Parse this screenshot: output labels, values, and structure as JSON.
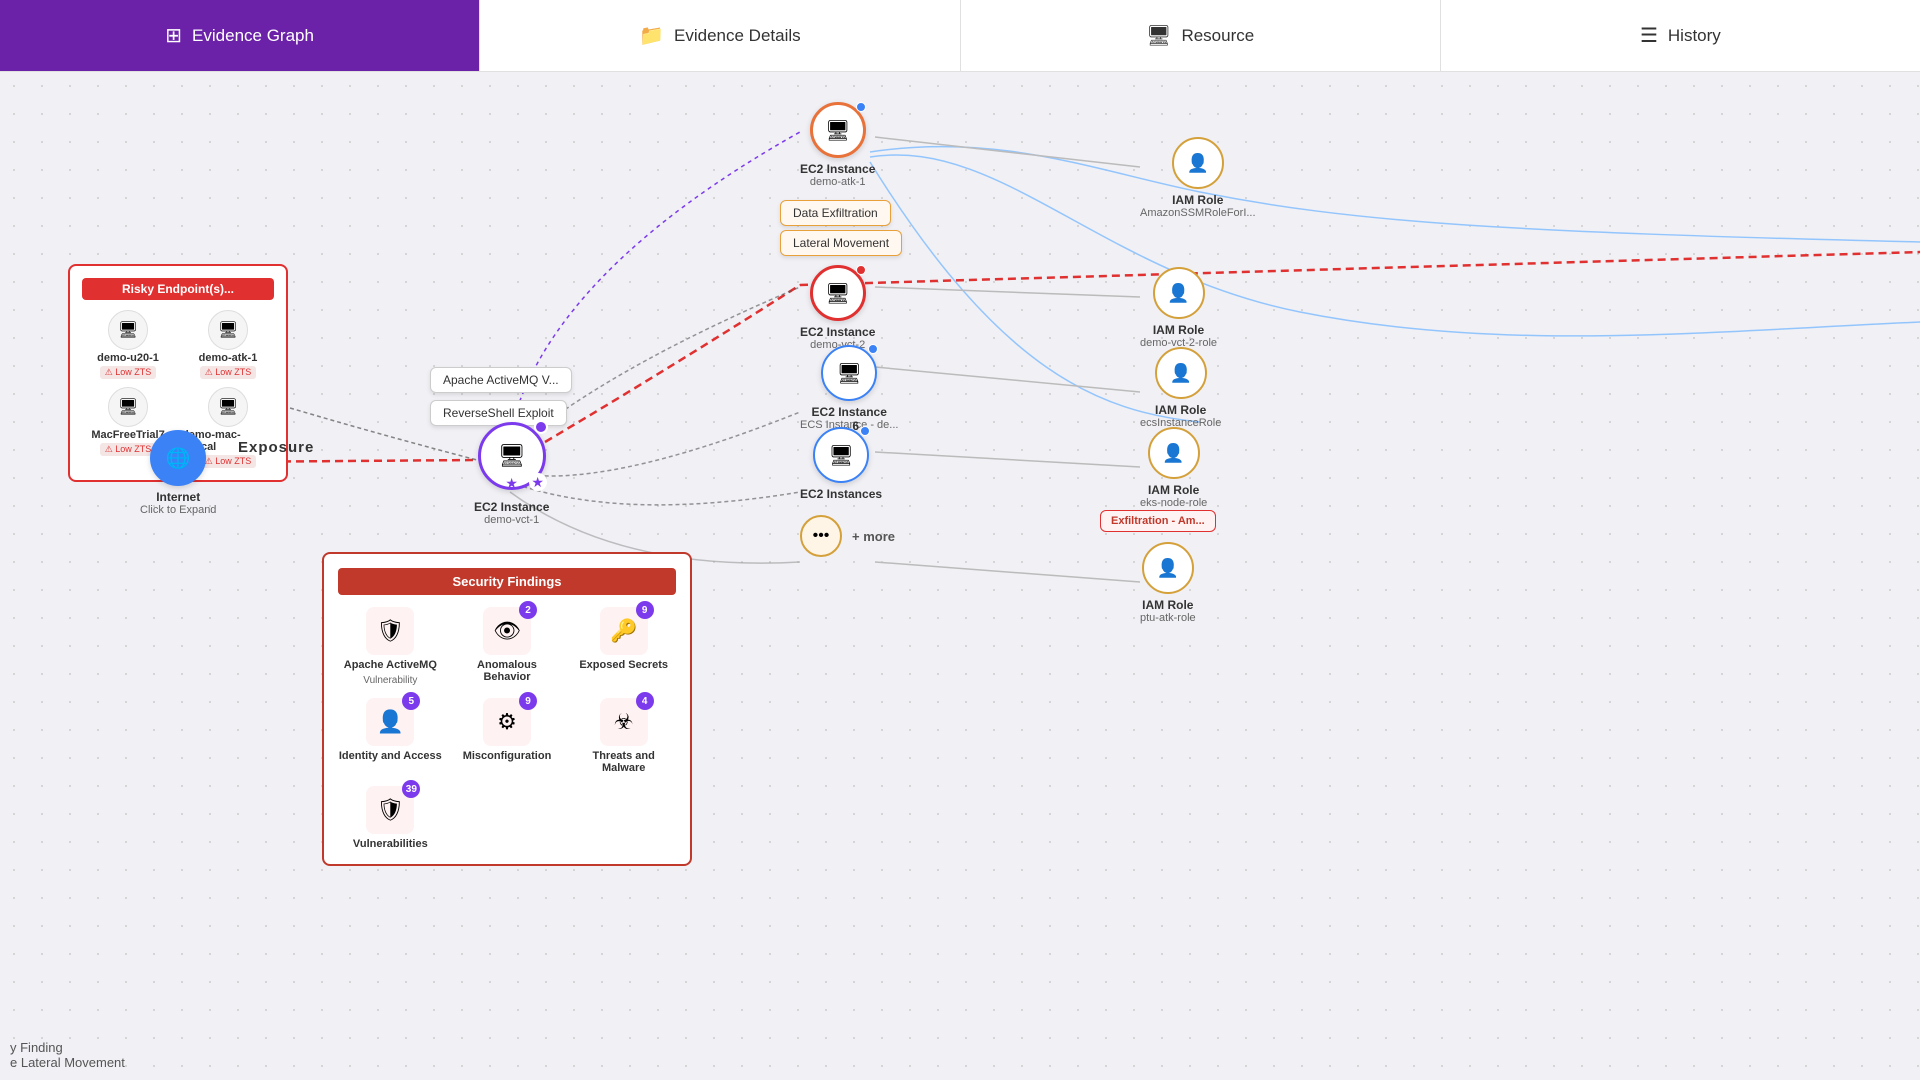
{
  "header": {
    "tabs": [
      {
        "id": "evidence-graph",
        "label": "Evidence Graph",
        "icon": "⬛",
        "active": true
      },
      {
        "id": "evidence-details",
        "label": "Evidence Details",
        "icon": "📁",
        "active": false
      },
      {
        "id": "resource",
        "label": "Resource",
        "icon": "🖥",
        "active": false
      },
      {
        "id": "history",
        "label": "History",
        "icon": "☰",
        "active": false
      }
    ]
  },
  "graph": {
    "exposure_label": "Exposure",
    "risky_endpoints": {
      "header": "Risky Endpoint(s)...",
      "items": [
        {
          "label": "demo-u20-1",
          "badge": "Low ZTS"
        },
        {
          "label": "demo-atk-1",
          "badge": "Low ZTS"
        },
        {
          "label": "MacFreeTrial7",
          "badge": "Low ZTS"
        },
        {
          "label": "demo-mac-1.local",
          "badge": "Low ZTS"
        }
      ]
    },
    "internet_node": {
      "label": "Internet",
      "sublabel": "Click to Expand"
    },
    "main_node": {
      "label": "EC2 Instance",
      "sublabel": "demo-vct-1"
    },
    "popup_labels": [
      "Apache ActiveMQ V...",
      "ReverseShell Exploit"
    ],
    "ec2_nodes": [
      {
        "label": "EC2 Instance",
        "sublabel": "demo-atk-1"
      },
      {
        "label": "EC2 Instance",
        "sublabel": "demo-vct-2"
      },
      {
        "label": "EC2 Instance",
        "sublabel": "ECS Instance - de..."
      },
      {
        "label": "EC2 Instances",
        "sublabel": "",
        "count": "6"
      }
    ],
    "iam_nodes": [
      {
        "label": "IAM Role",
        "sublabel": "AmazonSSMRoleForI..."
      },
      {
        "label": "IAM Role",
        "sublabel": "demo-vct-2-role"
      },
      {
        "label": "IAM Role",
        "sublabel": "ecsInstanceRole"
      },
      {
        "label": "IAM Role",
        "sublabel": "eks-node-role"
      },
      {
        "label": "IAM Role",
        "sublabel": "ptu-atk-role"
      }
    ],
    "more_label": "+ more",
    "exfiltration_label": "Exfiltration - Am...",
    "tactic_labels": [
      "Data Exfiltration",
      "Lateral Movement"
    ],
    "security_findings": {
      "header": "Security Findings",
      "items": [
        {
          "label": "Apache ActiveMQ",
          "sublabel": "Vulnerability",
          "icon": "🛡",
          "badge": null
        },
        {
          "label": "Anomalous Behavior",
          "sublabel": "",
          "icon": "👁",
          "badge": "2"
        },
        {
          "label": "Exposed Secrets",
          "sublabel": "",
          "icon": "🔑",
          "badge": "9"
        },
        {
          "label": "Identity and Access",
          "sublabel": "",
          "icon": "👤",
          "badge": "5"
        },
        {
          "label": "Misconfiguration",
          "sublabel": "",
          "icon": "⚙",
          "badge": "9"
        },
        {
          "label": "Threats and Malware",
          "sublabel": "",
          "icon": "☣",
          "badge": "4"
        },
        {
          "label": "Vulnerabilities",
          "sublabel": "",
          "icon": "🛡",
          "badge": "39"
        }
      ]
    }
  },
  "bottom_legend": {
    "line1": "y Finding",
    "line2": "e Lateral Movement"
  }
}
